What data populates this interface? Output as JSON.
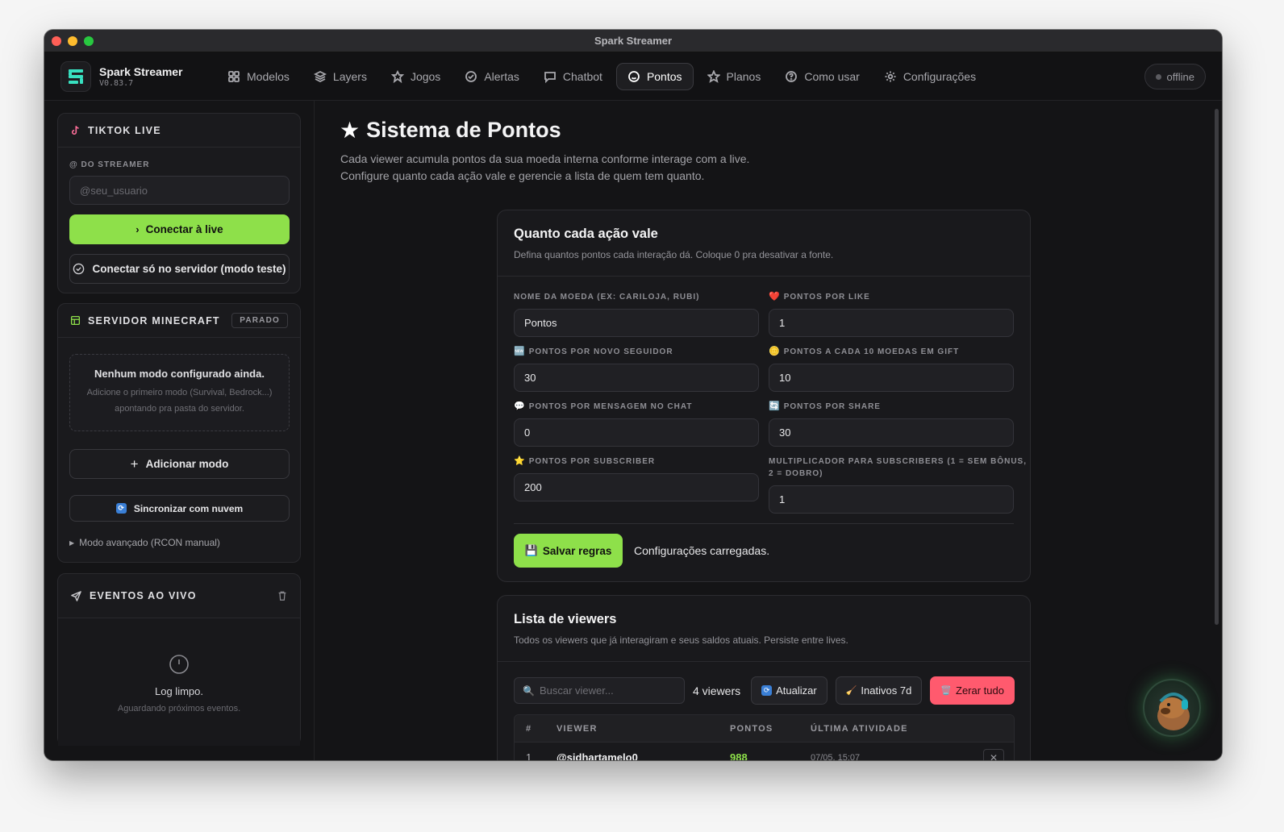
{
  "window": {
    "title": "Spark Streamer"
  },
  "brand": {
    "name": "Spark Streamer",
    "version": "V0.83.7"
  },
  "nav": {
    "tabs": [
      {
        "label": "Modelos",
        "icon": "grid-icon"
      },
      {
        "label": "Layers",
        "icon": "layers-icon"
      },
      {
        "label": "Jogos",
        "icon": "gamepad-icon"
      },
      {
        "label": "Alertas",
        "icon": "check-circle-icon"
      },
      {
        "label": "Chatbot",
        "icon": "chat-icon"
      },
      {
        "label": "Pontos",
        "icon": "smile-icon",
        "active": true
      },
      {
        "label": "Planos",
        "icon": "star-icon"
      },
      {
        "label": "Como usar",
        "icon": "help-icon"
      },
      {
        "label": "Configurações",
        "icon": "gear-icon"
      }
    ],
    "status": "offline"
  },
  "sidebar": {
    "tiktok": {
      "title": "TIKTOK LIVE",
      "field_label": "@ DO STREAMER",
      "placeholder": "@seu_usuario",
      "connect_label": "Conectar à live",
      "server_only_label": "Conectar só no servidor (modo teste)"
    },
    "minecraft": {
      "title": "SERVIDOR MINECRAFT",
      "status": "PARADO",
      "empty_title": "Nenhum modo configurado ainda.",
      "empty_text": "Adicione o primeiro modo (Survival, Bedrock...) apontando pra pasta do servidor.",
      "add_label": "Adicionar modo",
      "sync_label": "Sincronizar com nuvem",
      "advanced_label": "Modo avançado (RCON manual)"
    },
    "events": {
      "title": "EVENTOS AO VIVO",
      "empty_title": "Log limpo.",
      "empty_text": "Aguardando próximos eventos."
    }
  },
  "page": {
    "title": "Sistema de Pontos",
    "subtitle_line1": "Cada viewer acumula pontos da sua moeda interna conforme interage com a live.",
    "subtitle_line2": "Configure quanto cada ação vale e gerencie a lista de quem tem quanto."
  },
  "rules": {
    "title": "Quanto cada ação vale",
    "description": "Defina quantos pontos cada interação dá. Coloque 0 pra desativar a fonte.",
    "fields": [
      {
        "emoji": "",
        "label": "NOME DA MOEDA (EX: CARILOJA, RUBI)",
        "value": "Pontos"
      },
      {
        "emoji": "❤️",
        "label": "PONTOS POR LIKE",
        "value": "1"
      },
      {
        "emoji": "🆕",
        "label": "PONTOS POR NOVO SEGUIDOR",
        "value": "30"
      },
      {
        "emoji": "🪙",
        "label": "PONTOS A CADA 10 MOEDAS EM GIFT",
        "value": "10"
      },
      {
        "emoji": "💬",
        "label": "PONTOS POR MENSAGEM NO CHAT",
        "value": "0"
      },
      {
        "emoji": "🔄",
        "label": "PONTOS POR SHARE",
        "value": "30"
      },
      {
        "emoji": "⭐",
        "label": "PONTOS POR SUBSCRIBER",
        "value": "200"
      },
      {
        "emoji": "",
        "label_line1": "MULTIPLICADOR PARA SUBSCRIBERS (1 = SEM BÔNUS,",
        "label_line2": "2 = DOBRO)",
        "value": "1"
      }
    ],
    "save_label": "Salvar regras",
    "save_emoji": "💾",
    "status_message": "Configurações carregadas."
  },
  "viewers": {
    "title": "Lista de viewers",
    "description": "Todos os viewers que já interagiram e seus saldos atuais. Persiste entre lives.",
    "search_placeholder": "Buscar viewer...",
    "count_label": "4 viewers",
    "refresh_label": "Atualizar",
    "inactive_label": "Inativos 7d",
    "reset_label": "Zerar tudo",
    "columns": [
      "#",
      "VIEWER",
      "PONTOS",
      "ÚLTIMA ATIVIDADE"
    ],
    "rows": [
      {
        "rank": "1",
        "viewer": "@sidhartamelo0",
        "points": "988",
        "last": "07/05, 15:07"
      }
    ]
  },
  "colors": {
    "accent": "#8ee04a",
    "danger": "#ff5a6e",
    "background": "#141416"
  }
}
